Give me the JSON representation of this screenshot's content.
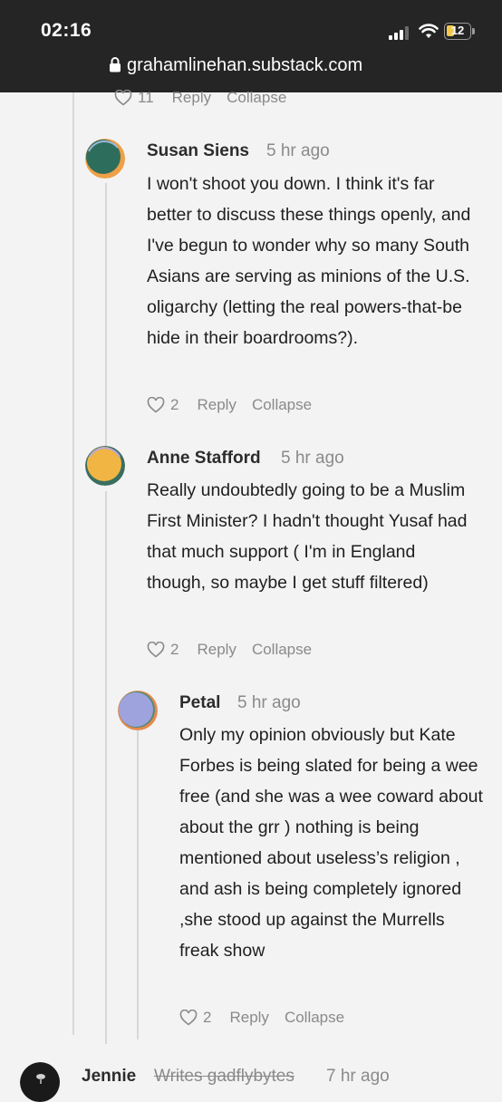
{
  "status_bar": {
    "time": "02:16",
    "battery": "12"
  },
  "browser": {
    "url": "grahamlinehan.substack.com"
  },
  "top_actions": {
    "likes": "11",
    "reply": "Reply",
    "collapse": "Collapse"
  },
  "comments": [
    {
      "author": "Susan Siens",
      "time": "5 hr ago",
      "body": "I won't shoot you down. I think it's far better to discuss these things openly, and I've begun to wonder why so many South Asians are serving as minions of the U.S. oligarchy (letting the real powers-that-be hide in their boardrooms?).",
      "likes": "2",
      "reply": "Reply",
      "collapse": "Collapse"
    },
    {
      "author": "Anne Stafford",
      "time": "5 hr ago",
      "body": "Really undoubtedly going to be a Muslim First Minister? I hadn't thought Yusaf had that much support ( I'm in England though, so maybe I get stuff filtered)",
      "likes": "2",
      "reply": "Reply",
      "collapse": "Collapse"
    },
    {
      "author": "Petal",
      "time": "5 hr ago",
      "body": "Only my opinion obviously but Kate Forbes is being slated for being a wee free (and she was a wee coward about about the grr ) nothing is being mentioned about useless’s religion , and ash is being completely ignored ,she stood up against the Murrells freak show",
      "likes": "2",
      "reply": "Reply",
      "collapse": "Collapse"
    }
  ],
  "next_comment": {
    "author": "Jennie",
    "subtitle": "Writes gadflybytes",
    "time": "7 hr ago"
  },
  "colors": {
    "topbar": "#252525",
    "background": "#f3f3f3",
    "muted": "#8a8a8a"
  }
}
